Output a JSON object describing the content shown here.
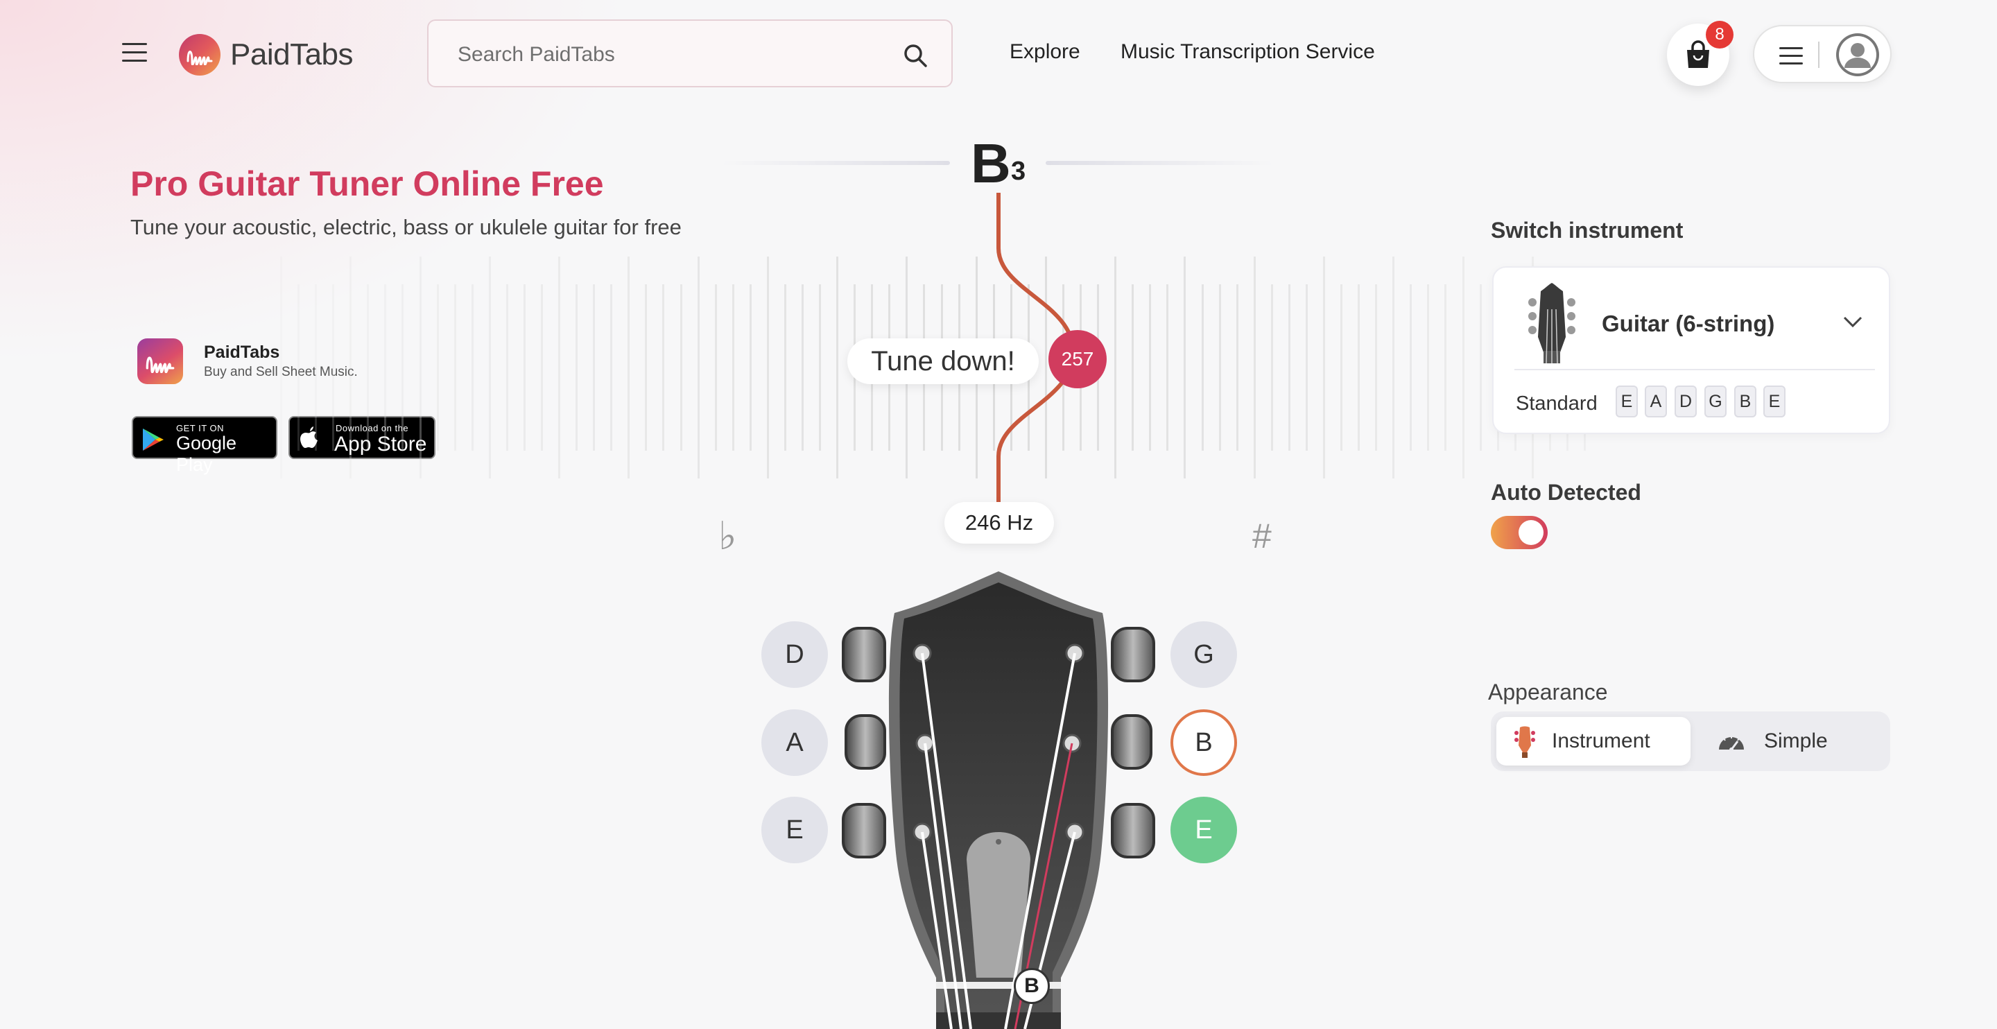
{
  "header": {
    "brand": "PaidTabs",
    "search_placeholder": "Search PaidTabs",
    "nav": [
      "Explore",
      "Music Transcription Service"
    ],
    "cart_count": "8"
  },
  "hero": {
    "title": "Pro Guitar Tuner Online Free",
    "subtitle": "Tune your acoustic, electric, bass or ukulele guitar for free"
  },
  "app_promo": {
    "name": "PaidTabs",
    "tagline": "Buy and Sell Sheet Music.",
    "google_small": "GET IT ON",
    "google_big": "Google Play",
    "apple_small": "Download on the",
    "apple_big": "App Store"
  },
  "tuner": {
    "note": "B",
    "octave": "3",
    "hint": "Tune down!",
    "cents": "257",
    "frequency": "246 Hz",
    "flat_symbol": "♭",
    "sharp_symbol": "#",
    "current_string": "B",
    "strings_left": [
      "D",
      "A",
      "E"
    ],
    "strings_right": [
      "G",
      "B",
      "E"
    ]
  },
  "panel": {
    "switch_label": "Switch instrument",
    "instrument": "Guitar (6-string)",
    "tuning_name": "Standard",
    "tuning_notes": [
      "E",
      "A",
      "D",
      "G",
      "B",
      "E"
    ],
    "auto_label": "Auto Detected",
    "auto_on": true,
    "appearance_label": "Appearance",
    "appearance_options": [
      "Instrument",
      "Simple"
    ],
    "appearance_selected": "Instrument"
  },
  "colors": {
    "brand": "#d13c5e",
    "accent_orange": "#e0774a",
    "tuned_green": "#6dcc8f"
  }
}
